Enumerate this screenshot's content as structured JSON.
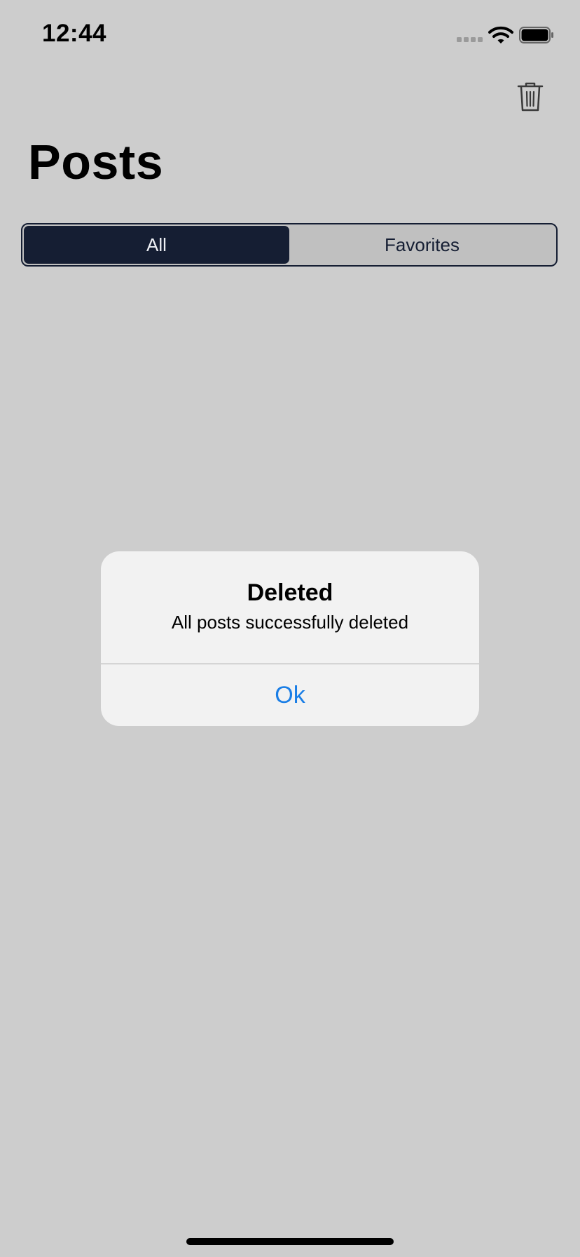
{
  "status_bar": {
    "time": "12:44",
    "icons": [
      "cellular-signal-icon",
      "wifi-icon",
      "battery-icon"
    ]
  },
  "nav": {
    "trash_icon": "trash-icon",
    "title": "Posts"
  },
  "segmented_control": {
    "segments": [
      "All",
      "Favorites"
    ],
    "selected": "All"
  },
  "alert": {
    "title": "Deleted",
    "message": "All posts successfully deleted",
    "button": "Ok"
  },
  "colors": {
    "background": "#cdcdcd",
    "accent_dark": "#151e33",
    "alert_button": "#1a7ee6"
  }
}
